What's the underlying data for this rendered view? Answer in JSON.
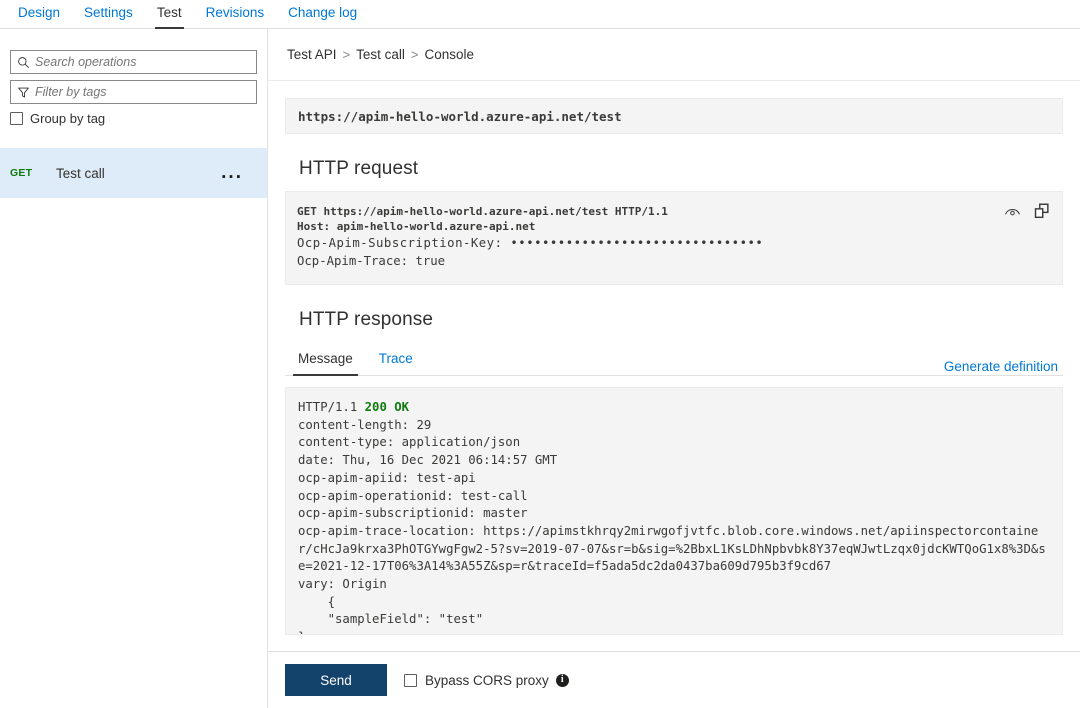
{
  "tabs": [
    {
      "label": "Design",
      "active": false
    },
    {
      "label": "Settings",
      "active": false
    },
    {
      "label": "Test",
      "active": true
    },
    {
      "label": "Revisions",
      "active": false
    },
    {
      "label": "Change log",
      "active": false
    }
  ],
  "sidebar": {
    "search_placeholder": "Search operations",
    "search_value": "",
    "filter_placeholder": "Filter by tags",
    "filter_value": "",
    "group_by_tag_label": "Group by tag",
    "operations": [
      {
        "verb": "GET",
        "name": "Test call",
        "menu": "..."
      }
    ]
  },
  "breadcrumb": {
    "items": [
      "Test API",
      "Test call",
      "Console"
    ],
    "separator": ">"
  },
  "console": {
    "url": "https://apim-hello-world.azure-api.net/test",
    "request_heading": "HTTP request",
    "request_lines": [
      "GET https://apim-hello-world.azure-api.net/test HTTP/1.1",
      "Host: apim-hello-world.azure-api.net",
      "Ocp-Apim-Subscription-Key: ••••••••••••••••••••••••••••••••",
      "Ocp-Apim-Trace: true"
    ],
    "response_heading": "HTTP response",
    "response_tabs": [
      {
        "label": "Message",
        "active": true
      },
      {
        "label": "Trace",
        "active": false
      }
    ],
    "generate_definition_label": "Generate definition",
    "status_line_prefix": "HTTP/1.1 ",
    "status_code": "200 OK",
    "response_lines": [
      "content-length: 29",
      "content-type: application/json",
      "date: Thu, 16 Dec 2021 06:14:57 GMT",
      "ocp-apim-apiid: test-api",
      "ocp-apim-operationid: test-call",
      "ocp-apim-subscriptionid: master",
      "ocp-apim-trace-location: https://apimstkhrqy2mirwgofjvtfc.blob.core.windows.net/apiinspectorcontainer/cHcJa9krxa3PhOTGYwgFgw2-5?sv=2019-07-07&sr=b&sig=%2BbxL1KsLDhNpbvbk8Y37eqWJwtLzqx0jdcKWTQoG1x8%3D&se=2021-12-17T06%3A14%3A55Z&sp=r&traceId=f5ada5dc2da0437ba609d795b3f9cd67",
      "vary: Origin",
      "    {",
      "    \"sampleField\": \"test\"",
      "}"
    ]
  },
  "footer": {
    "send_label": "Send",
    "bypass_cors_label": "Bypass CORS proxy",
    "info_glyph": "i"
  },
  "icons": {
    "search": "search-icon",
    "filter": "filter-icon",
    "eye": "eye-icon",
    "copy": "copy-icon"
  },
  "colors": {
    "link": "#0078d4",
    "success": "#107c10",
    "selected_row": "#deecf9",
    "button": "#13426b"
  }
}
